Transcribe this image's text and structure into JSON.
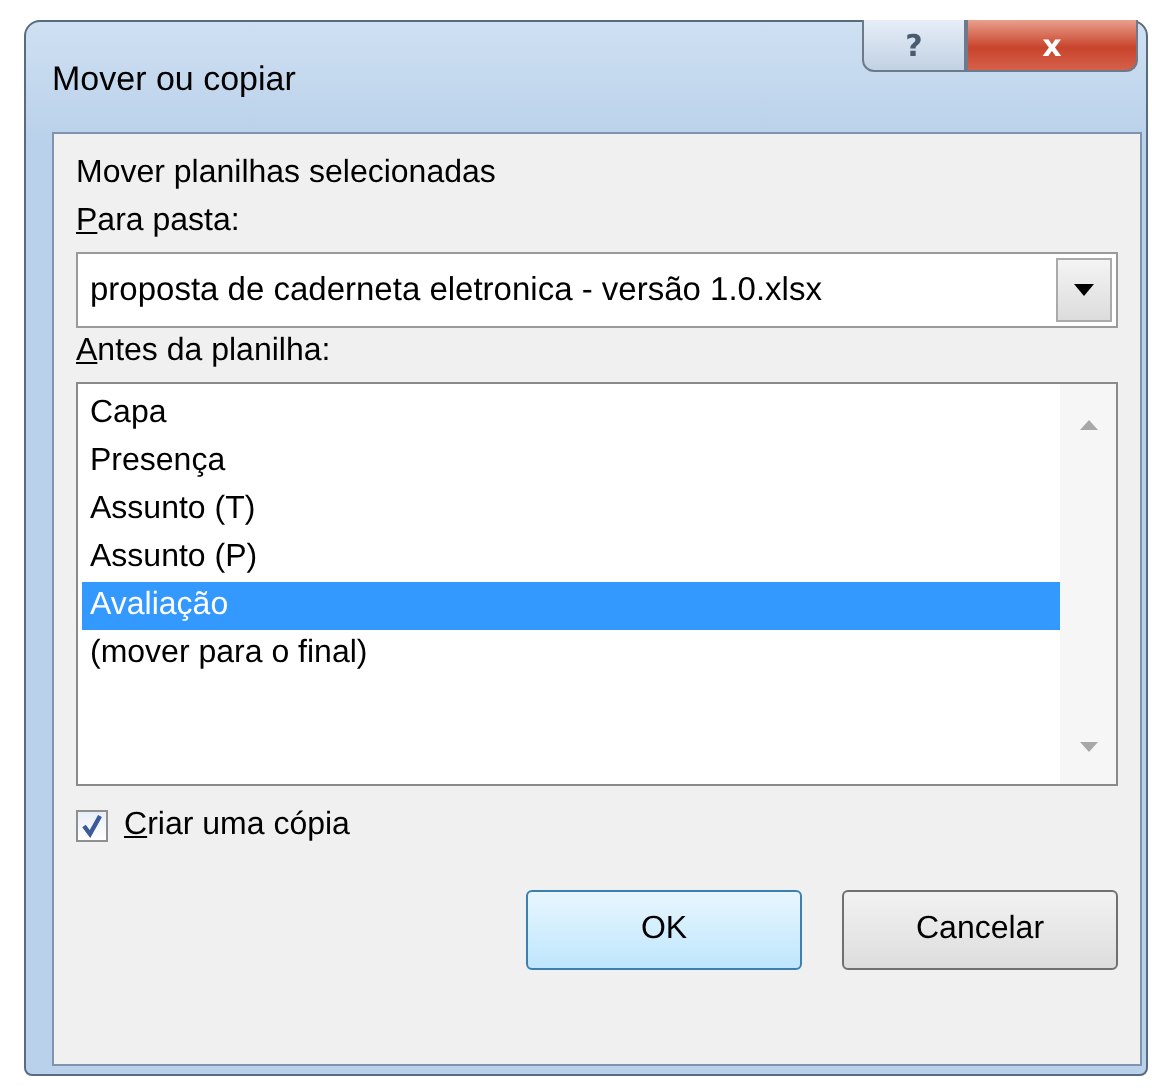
{
  "window": {
    "title": "Mover ou copiar",
    "buttons": [
      "?",
      "x"
    ]
  },
  "heading": "Mover planilhas selecionadas",
  "folder": {
    "label_key": "P",
    "label_rest": "ara pasta:",
    "value": "proposta de caderneta eletronica - versão 1.0.xlsx"
  },
  "sheets": {
    "label_key": "A",
    "label_rest": "ntes da planilha:",
    "items": [
      {
        "label": "Capa",
        "selected": false
      },
      {
        "label": "Presença",
        "selected": false
      },
      {
        "label": "Assunto (T)",
        "selected": false
      },
      {
        "label": "Assunto (P)",
        "selected": false
      },
      {
        "label": "Avaliação",
        "selected": true
      },
      {
        "label": "(mover para o final)",
        "selected": false
      }
    ]
  },
  "copy": {
    "label_key": "C",
    "label_rest": "riar uma cópia",
    "checked": true
  },
  "buttons": [
    {
      "label": "OK",
      "kind": "default"
    },
    {
      "label": "Cancelar",
      "kind": "normal"
    }
  ]
}
